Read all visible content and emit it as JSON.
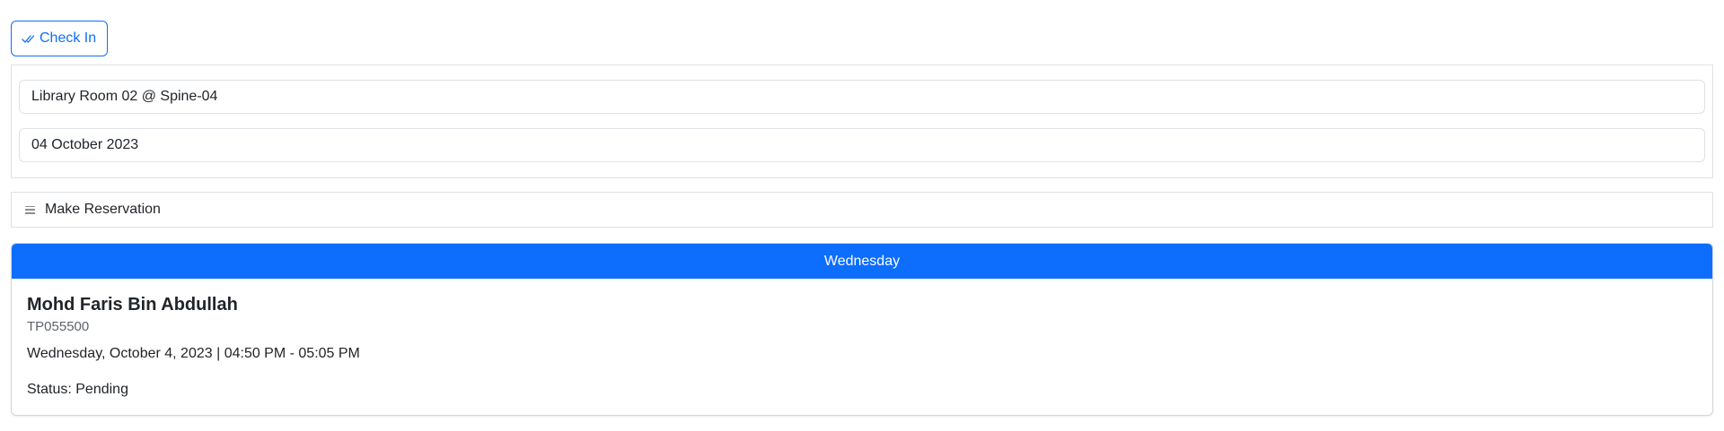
{
  "toolbar": {
    "checkin_label": "Check In",
    "checkin_icon": "double-check-icon",
    "accent_color": "#0d6efd"
  },
  "filters": {
    "room": "Library Room 02 @ Spine-04",
    "date": "04 October 2023"
  },
  "reservation_menu": {
    "label": "Make Reservation",
    "icon": "menu-icon"
  },
  "schedule": {
    "day": "Wednesday",
    "reservation": {
      "name": "Mohd Faris Bin Abdullah",
      "student_id": "TP055500",
      "datetime": "Wednesday, October 4, 2023 | 04:50 PM - 05:05 PM",
      "status": "Status: Pending"
    }
  }
}
